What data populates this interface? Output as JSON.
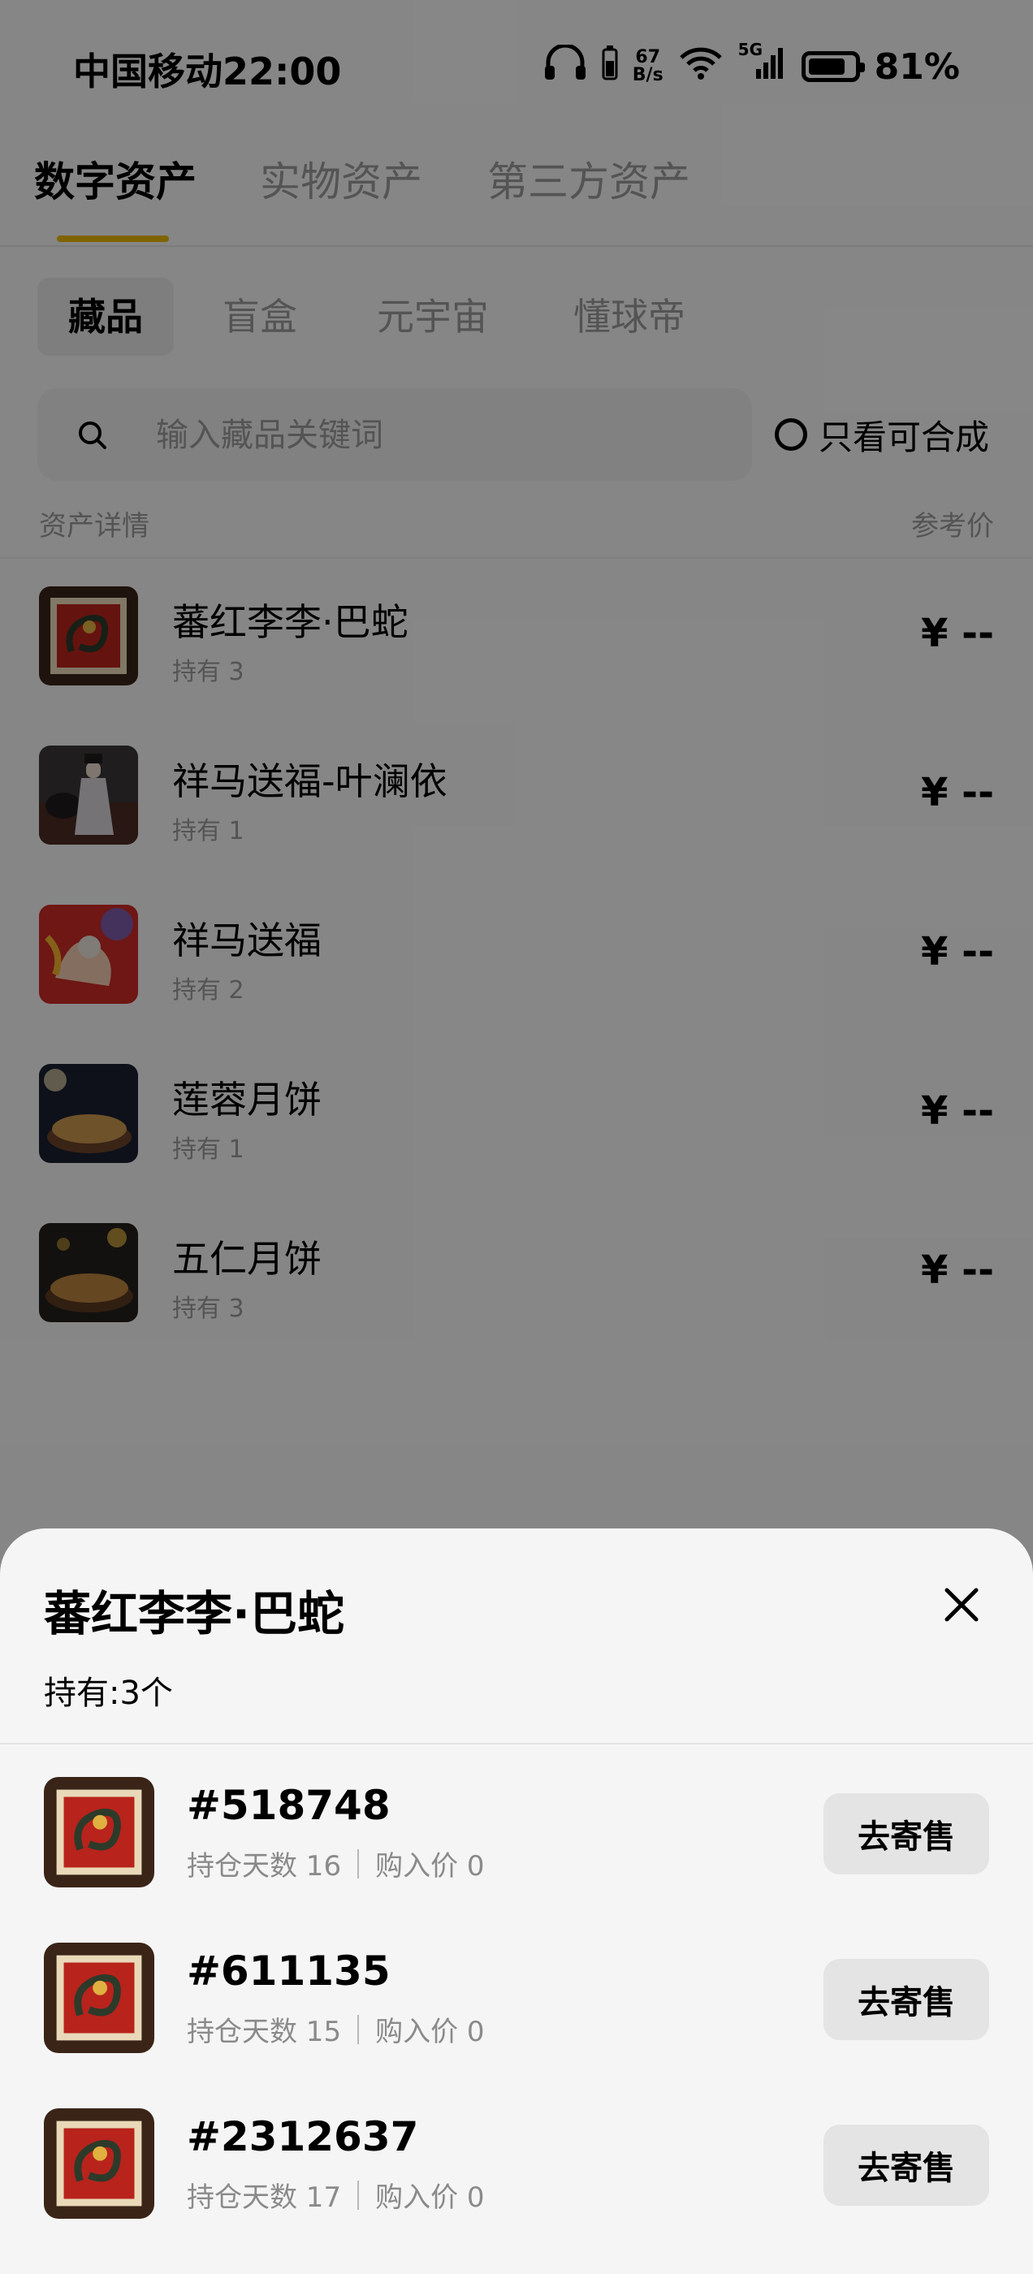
{
  "status_bar": {
    "carrier": "中国移动",
    "time": "22:00",
    "net_speed_value": "67",
    "net_speed_unit": "B/s",
    "network_type": "5G",
    "battery_percent": "81%",
    "battery_level": 0.81,
    "icons": [
      "headphones-icon",
      "wifi-icon",
      "signal-icon",
      "battery-icon"
    ]
  },
  "tabs": [
    {
      "label": "数字资产",
      "active": true
    },
    {
      "label": "实物资产",
      "active": false
    },
    {
      "label": "第三方资产",
      "active": false
    }
  ],
  "sub_tabs": [
    {
      "label": "藏品",
      "active": true
    },
    {
      "label": "盲盒",
      "active": false
    },
    {
      "label": "元宇宙",
      "active": false
    },
    {
      "label": "懂球帝",
      "active": false
    }
  ],
  "search": {
    "placeholder": "输入藏品关键词",
    "value": ""
  },
  "filter": {
    "label": "只看可合成",
    "checked": false
  },
  "list_header": {
    "left": "资产详情",
    "right": "参考价"
  },
  "assets": [
    {
      "name": "蕃红李李·巴蛇",
      "holding": "持有 3",
      "price": "¥ --",
      "thumb_icon": "dragon-artwork-thumbnail"
    },
    {
      "name": "祥马送福-叶澜依",
      "holding": "持有 1",
      "price": "¥ --",
      "thumb_icon": "horse-lady-artwork-thumbnail"
    },
    {
      "name": "祥马送福",
      "holding": "持有 2",
      "price": "¥ --",
      "thumb_icon": "red-horse-artwork-thumbnail"
    },
    {
      "name": "莲蓉月饼",
      "holding": "持有 1",
      "price": "¥ --",
      "thumb_icon": "mooncake-thumbnail"
    },
    {
      "name": "五仁月饼",
      "holding": "持有 3",
      "price": "¥ --",
      "thumb_icon": "mooncake-thumbnail"
    }
  ],
  "sheet": {
    "title": "蕃红李李·巴蛇",
    "holding": "持有:3个",
    "items": [
      {
        "id": "#518748",
        "days_label": "持仓天数 16",
        "price_label": "购入价 0",
        "button": "去寄售"
      },
      {
        "id": "#611135",
        "days_label": "持仓天数 15",
        "price_label": "购入价 0",
        "button": "去寄售"
      },
      {
        "id": "#2312637",
        "days_label": "持仓天数 17",
        "price_label": "购入价 0",
        "button": "去寄售"
      }
    ]
  },
  "colors": {
    "accent": "#e8b400",
    "overlay": "rgba(0,0,0,0.45)",
    "sheet_bg": "#f5f5f5",
    "muted_text": "#9a9a9a"
  }
}
